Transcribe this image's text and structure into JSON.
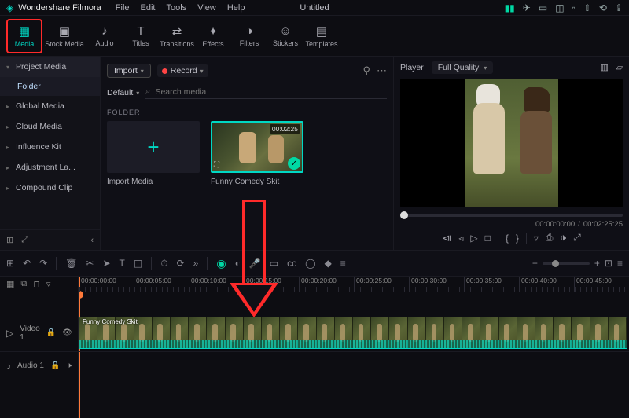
{
  "app": {
    "brand": "Wondershare Filmora",
    "title": "Untitled"
  },
  "menu": [
    "File",
    "Edit",
    "Tools",
    "View",
    "Help"
  ],
  "tabs": [
    {
      "id": "media",
      "label": "Media",
      "icon": "▦",
      "active": true
    },
    {
      "id": "stock",
      "label": "Stock Media",
      "icon": "▣"
    },
    {
      "id": "audio",
      "label": "Audio",
      "icon": "♪"
    },
    {
      "id": "titles",
      "label": "Titles",
      "icon": "T"
    },
    {
      "id": "transitions",
      "label": "Transitions",
      "icon": "⇄"
    },
    {
      "id": "effects",
      "label": "Effects",
      "icon": "✦"
    },
    {
      "id": "filters",
      "label": "Filters",
      "icon": "◑"
    },
    {
      "id": "stickers",
      "label": "Stickers",
      "icon": "☺"
    },
    {
      "id": "templates",
      "label": "Templates",
      "icon": "▤"
    }
  ],
  "sidebar": {
    "items": [
      {
        "label": "Project Media",
        "expanded": true,
        "sub": "Folder"
      },
      {
        "label": "Global Media"
      },
      {
        "label": "Cloud Media"
      },
      {
        "label": "Influence Kit"
      },
      {
        "label": "Adjustment La..."
      },
      {
        "label": "Compound Clip"
      }
    ]
  },
  "mediaPanel": {
    "import_label": "Import",
    "record_label": "Record",
    "default_label": "Default",
    "search_placeholder": "Search media",
    "folder_heading": "FOLDER",
    "import_tile": "Import Media",
    "clip": {
      "name": "Funny Comedy Skit",
      "duration": "00:02:25"
    }
  },
  "player": {
    "label": "Player",
    "quality": "Full Quality",
    "current": "00:00:00:00",
    "total": "00:02:25:25"
  },
  "timeline": {
    "ticks": [
      "00:00:00:00",
      "00:00:05:00",
      "00:00:10:00",
      "00:00:15:00",
      "00:00:20:00",
      "00:00:25:00",
      "00:00:30:00",
      "00:00:35:00",
      "00:00:40:00",
      "00:00:45:00"
    ],
    "video_track": "Video 1",
    "audio_track": "Audio 1",
    "clip_name": "Funny Comedy Skit"
  }
}
